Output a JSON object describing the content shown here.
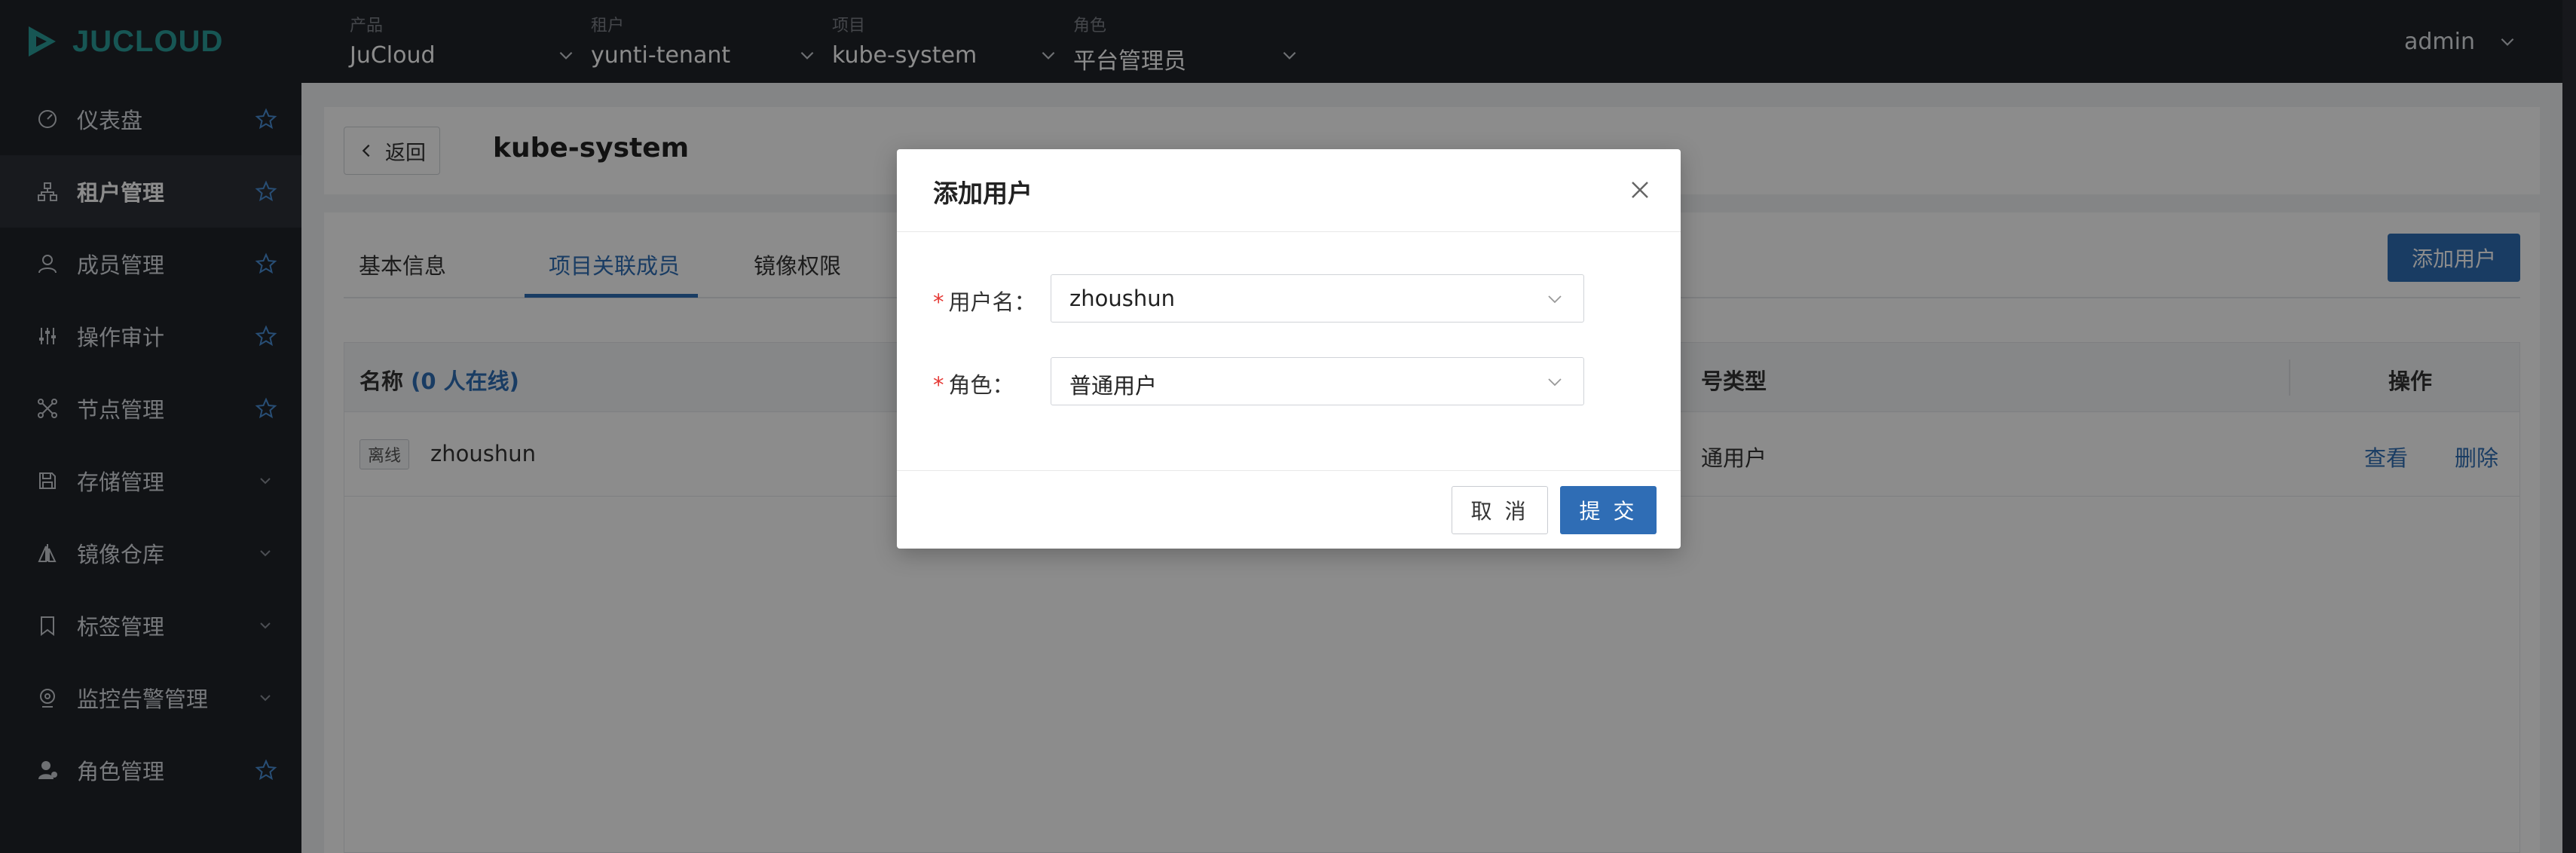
{
  "app": {
    "logo_text": "JUCLOUD"
  },
  "topbar": {
    "selectors": [
      {
        "label": "产品",
        "value": "JuCloud"
      },
      {
        "label": "租户",
        "value": "yunti-tenant"
      },
      {
        "label": "项目",
        "value": "kube-system"
      },
      {
        "label": "角色",
        "value": "平台管理员"
      }
    ],
    "user": "admin"
  },
  "sidebar": {
    "items": [
      {
        "label": "仪表盘",
        "icon": "dashboard-icon",
        "trailing": "star"
      },
      {
        "label": "租户管理",
        "icon": "tenant-icon",
        "trailing": "star",
        "active": true
      },
      {
        "label": "成员管理",
        "icon": "member-icon",
        "trailing": "star"
      },
      {
        "label": "操作审计",
        "icon": "audit-icon",
        "trailing": "star"
      },
      {
        "label": "节点管理",
        "icon": "node-icon",
        "trailing": "star"
      },
      {
        "label": "存储管理",
        "icon": "storage-icon",
        "trailing": "chevron"
      },
      {
        "label": "镜像仓库",
        "icon": "registry-icon",
        "trailing": "chevron"
      },
      {
        "label": "标签管理",
        "icon": "tag-icon",
        "trailing": "chevron"
      },
      {
        "label": "监控告警管理",
        "icon": "monitor-icon",
        "trailing": "chevron"
      },
      {
        "label": "角色管理",
        "icon": "role-icon",
        "trailing": "star"
      }
    ]
  },
  "header": {
    "back_label": "返回",
    "title": "kube-system"
  },
  "tabs": [
    {
      "label": "基本信息"
    },
    {
      "label": "项目关联成员",
      "active": true
    },
    {
      "label": "镜像权限"
    }
  ],
  "toolbar": {
    "add_user_label": "添加用户"
  },
  "table": {
    "columns": {
      "name": "名称",
      "online_count": "(0 人在线)",
      "account_type": "号类型",
      "actions": "操作"
    },
    "rows": [
      {
        "status": "离线",
        "name": "zhoushun",
        "account_type": "通用户",
        "view": "查看",
        "delete": "删除"
      }
    ]
  },
  "modal": {
    "title": "添加用户",
    "fields": {
      "username": {
        "label": "用户名：",
        "value": "zhoushun"
      },
      "role": {
        "label": "角色：",
        "value": "普通用户"
      }
    },
    "cancel_label": "取 消",
    "submit_label": "提 交"
  },
  "colors": {
    "topbar_bg": "#1f2329",
    "accent": "#2f6db5",
    "logo": "#2a9d9a",
    "required": "#e53935"
  }
}
